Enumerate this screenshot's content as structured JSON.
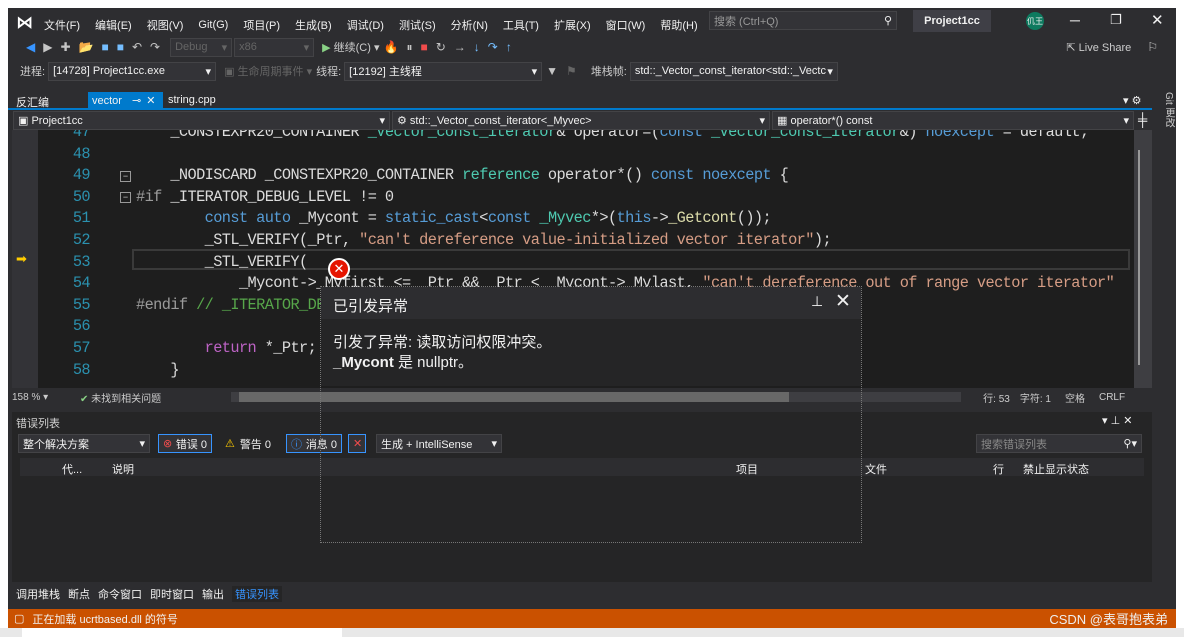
{
  "menu": [
    "文件(F)",
    "编辑(E)",
    "视图(V)",
    "Git(G)",
    "项目(P)",
    "生成(B)",
    "调试(D)",
    "测试(S)",
    "分析(N)",
    "工具(T)",
    "扩展(X)",
    "窗口(W)",
    "帮助(H)"
  ],
  "search_placeholder": "搜索 (Ctrl+Q)",
  "solution_name": "Project1cc",
  "avatar_initials": "仉王",
  "toolbar": {
    "config": "Debug",
    "platform": "x86",
    "continue": "继续(C)",
    "live_share": "Live Share"
  },
  "debug_bar": {
    "process_label": "进程:",
    "process": "[14728] Project1cc.exe",
    "lifecycle": "生命周期事件",
    "thread_label": "线程:",
    "thread": "[12192] 主线程",
    "stack_label": "堆栈帧:",
    "stack": "std::_Vector_const_iterator<std::_Vectc"
  },
  "tabs": [
    {
      "label": "反汇编"
    },
    {
      "label": "vector",
      "active": true
    },
    {
      "label": "string.cpp"
    }
  ],
  "git_sidebar": "Git 更改",
  "nav": {
    "project": "Project1cc",
    "scope": "std::_Vector_const_iterator<_Myvec>",
    "member": "operator*() const"
  },
  "code": {
    "current_line": 53,
    "lines": [
      {
        "n": "47",
        "t": "    _CONSTEXPR20_CONTAINER _Vector_const_iterator& operator=(const _Vector_const_iterator&) noexcept = default;"
      },
      {
        "n": "48",
        "t": ""
      },
      {
        "n": "49",
        "t": "    _NODISCARD _CONSTEXPR20_CONTAINER reference operator*() const noexcept {"
      },
      {
        "n": "50",
        "t": "#if _ITERATOR_DEBUG_LEVEL != 0"
      },
      {
        "n": "51",
        "t": "        const auto _Mycont = static_cast<const _Myvec*>(this->_Getcont());"
      },
      {
        "n": "52",
        "t": "        _STL_VERIFY(_Ptr, \"can't dereference value-initialized vector iterator\");"
      },
      {
        "n": "53",
        "t": "        _STL_VERIFY("
      },
      {
        "n": "54",
        "t": "            _Mycont->_Myfirst <= _Ptr && _Ptr < _Mycont->_Mylast, \"can't dereference out of range vector iterator\""
      },
      {
        "n": "55",
        "t": "#endif // _ITERATOR_DEBUG_LEVEL != 0"
      },
      {
        "n": "56",
        "t": ""
      },
      {
        "n": "57",
        "t": "        return *_Ptr;"
      },
      {
        "n": "58",
        "t": "    }"
      }
    ]
  },
  "exception": {
    "title": "已引发异常",
    "message": "引发了异常: 读取访问权限冲突。",
    "var": "_Mycont",
    "detail": " 是 nullptr。"
  },
  "editor_status": {
    "zoom": "158 %",
    "issues": "未找到相关问题",
    "line": "行: 53",
    "char": "字符: 1",
    "spaces": "空格",
    "eol": "CRLF"
  },
  "error_list": {
    "title": "错误列表",
    "scope": "整个解决方案",
    "errors": "错误 0",
    "warnings": "警告 0",
    "messages": "消息 0",
    "source": "生成 + IntelliSense",
    "search_placeholder": "搜索错误列表",
    "columns": [
      "代...",
      "说明",
      "项目",
      "文件",
      "行",
      "禁止显示状态"
    ]
  },
  "bottom_tabs": [
    "调用堆栈",
    "断点",
    "命令窗口",
    "即时窗口",
    "输出",
    "错误列表"
  ],
  "status_bar": {
    "text": "正在加载 ucrtbased.dll 的符号",
    "watermark": "CSDN @表哥抱表弟",
    "color": "#ca5100"
  }
}
